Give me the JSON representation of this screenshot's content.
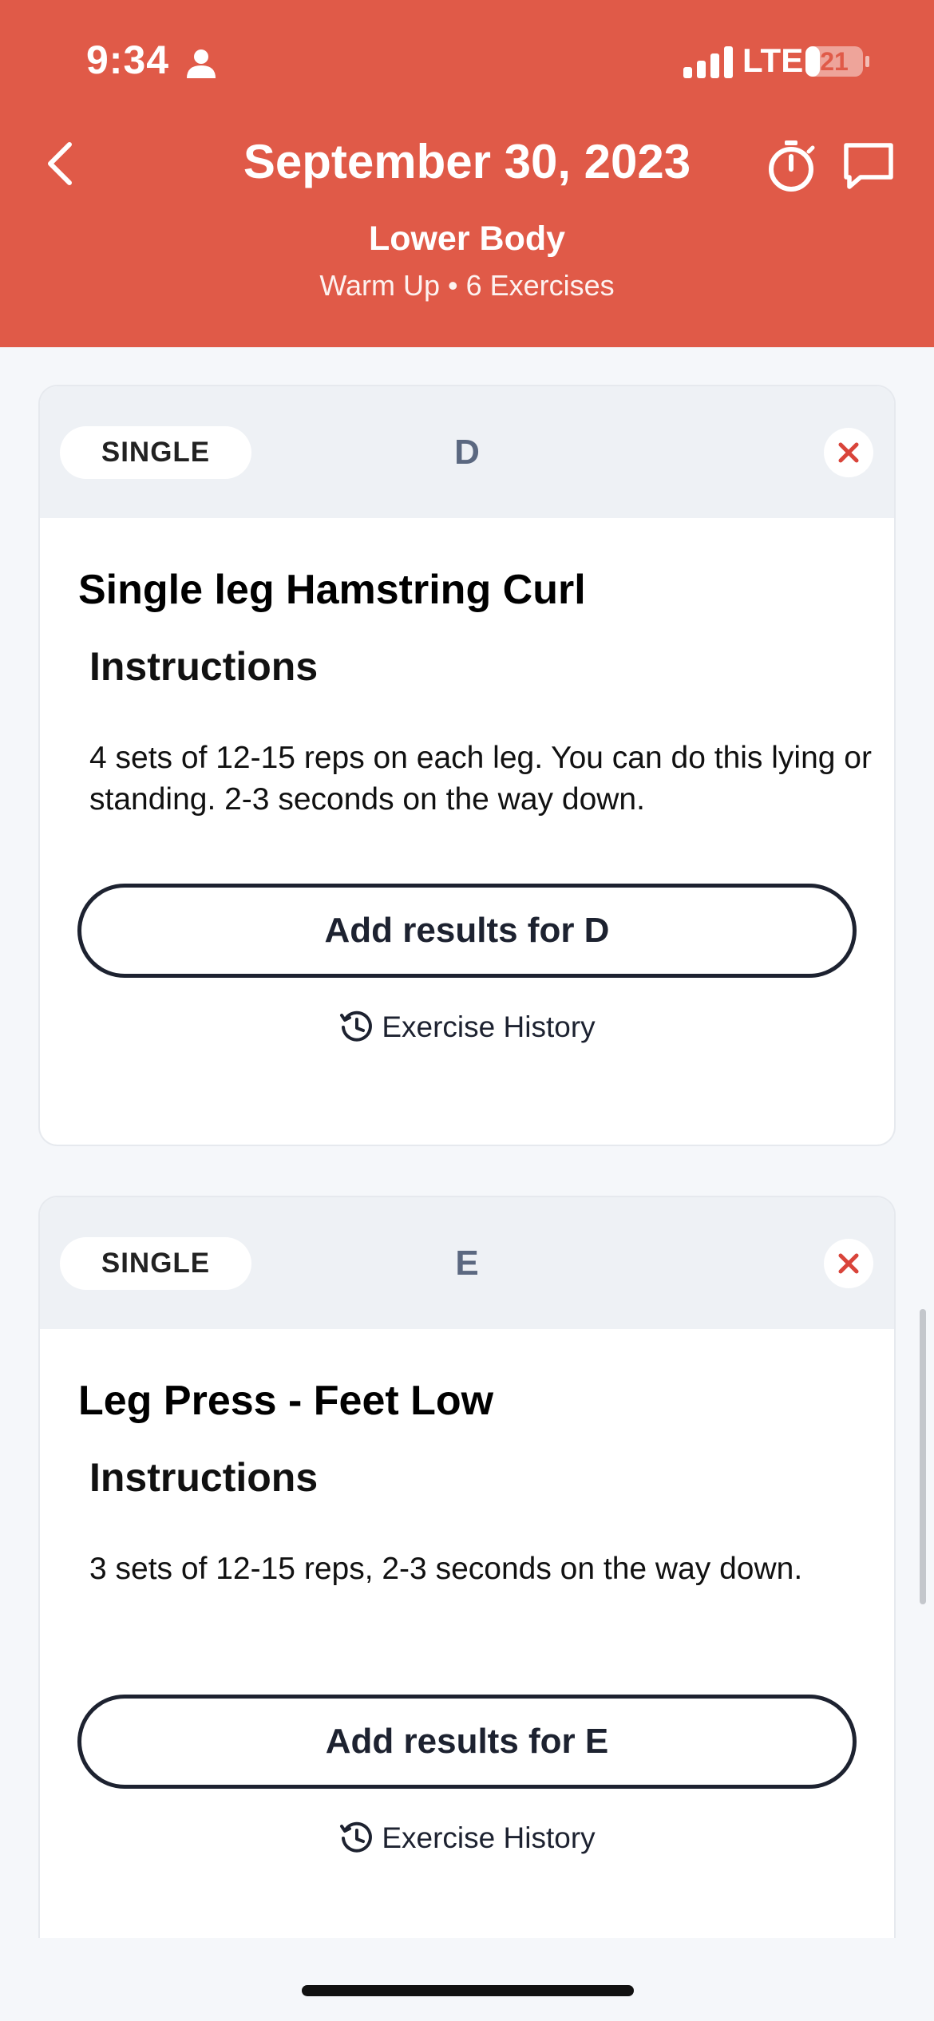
{
  "status_bar": {
    "time": "9:34",
    "network": "LTE",
    "battery": "21"
  },
  "nav": {
    "title": "September 30, 2023"
  },
  "workout": {
    "name": "Lower Body",
    "meta": "Warm Up • 6 Exercises"
  },
  "exercises": [
    {
      "type": "SINGLE",
      "letter": "D",
      "title": "Single leg Hamstring Curl",
      "instructions_heading": "Instructions",
      "instructions": "4 sets of 12-15 reps on each leg. You can do this lying or standing. 2-3 seconds on the way down.",
      "add_results_label": "Add results for D",
      "history_label": "Exercise History"
    },
    {
      "type": "SINGLE",
      "letter": "E",
      "title": "Leg Press - Feet Low",
      "instructions_heading": "Instructions",
      "instructions": "3 sets of 12-15 reps, 2-3 seconds on the way down.",
      "add_results_label": "Add results for E",
      "history_label": "Exercise History"
    }
  ],
  "colors": {
    "header_bg": "#e05a48",
    "remove_icon": "#d9443a",
    "letter": "#5b6880"
  },
  "icons": [
    "person-icon",
    "signal-icon",
    "battery-icon",
    "back-chevron-icon",
    "stopwatch-icon",
    "chat-icon",
    "close-icon",
    "history-icon"
  ]
}
